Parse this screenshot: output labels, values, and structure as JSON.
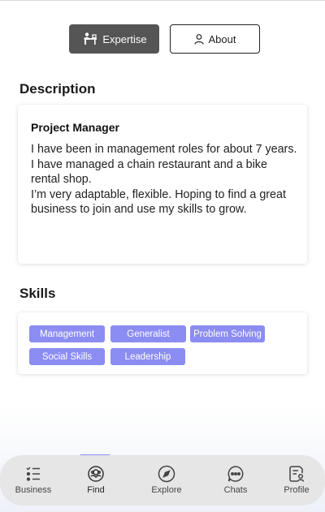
{
  "toggle": {
    "expertise_label": "Expertise",
    "about_label": "About",
    "expertise_icon": "desk-person-icon",
    "about_icon": "person-icon"
  },
  "description": {
    "section_title": "Description",
    "role": "Project Manager",
    "text": "I have been in management roles for about 7 years. I have managed a chain restaurant and a bike rental shop.\nI’m very adaptable, flexible. Hoping to find a great business to join and use my skills to grow."
  },
  "skills": {
    "section_title": "Skills",
    "items": [
      "Management",
      "Generalist",
      "Problem Solving",
      "Social Skills",
      "Leadership"
    ],
    "chip_color": "#8b8df2"
  },
  "nav": {
    "items": [
      {
        "label": "Business",
        "icon": "checklist-icon"
      },
      {
        "label": "Find",
        "icon": "find-wheel-icon"
      },
      {
        "label": "Explore",
        "icon": "compass-icon"
      },
      {
        "label": "Chats",
        "icon": "chat-bubble-icon"
      },
      {
        "label": "Profile",
        "icon": "profile-document-icon"
      }
    ],
    "active": "Find",
    "accent": "#8b8df2"
  }
}
